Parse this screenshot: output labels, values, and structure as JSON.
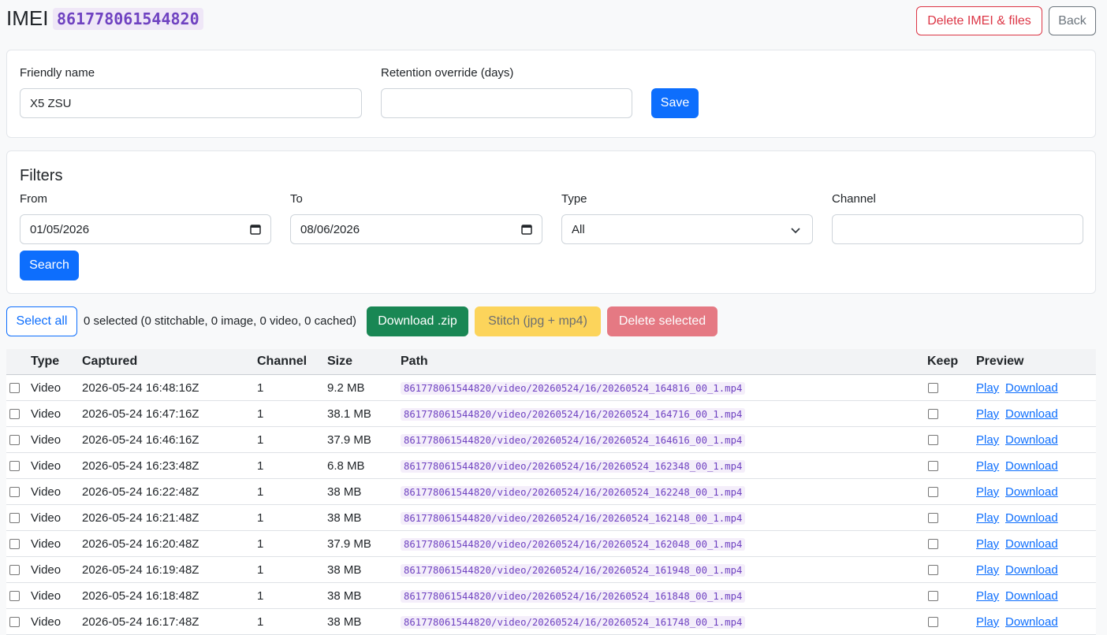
{
  "header": {
    "title": "IMEI",
    "imei": "861778061544820",
    "delete_button": "Delete IMEI & files",
    "back_button": "Back"
  },
  "settings": {
    "friendly_label": "Friendly name",
    "friendly_value": "X5 ZSU",
    "retention_label": "Retention override (days)",
    "retention_value": "",
    "save_button": "Save"
  },
  "filters": {
    "title": "Filters",
    "from_label": "From",
    "from_value": "01/05/2026",
    "to_label": "To",
    "to_value": "08/06/2026",
    "type_label": "Type",
    "type_value": "All",
    "channel_label": "Channel",
    "channel_value": "",
    "search_button": "Search"
  },
  "toolbar": {
    "select_all": "Select all",
    "selection_status": "0 selected (0 stitchable, 0 image, 0 video, 0 cached)",
    "download_zip": "Download .zip",
    "stitch": "Stitch (jpg + mp4)",
    "delete_selected": "Delete selected"
  },
  "table": {
    "headers": [
      "Type",
      "Captured",
      "Channel",
      "Size",
      "Path",
      "Keep",
      "Preview"
    ],
    "play_label": "Play",
    "download_label": "Download",
    "rows": [
      {
        "type": "Video",
        "captured": "2026-05-24 16:48:16Z",
        "channel": "1",
        "size": "9.2 MB",
        "path": "861778061544820/video/20260524/16/20260524_164816_00_1.mp4"
      },
      {
        "type": "Video",
        "captured": "2026-05-24 16:47:16Z",
        "channel": "1",
        "size": "38.1 MB",
        "path": "861778061544820/video/20260524/16/20260524_164716_00_1.mp4"
      },
      {
        "type": "Video",
        "captured": "2026-05-24 16:46:16Z",
        "channel": "1",
        "size": "37.9 MB",
        "path": "861778061544820/video/20260524/16/20260524_164616_00_1.mp4"
      },
      {
        "type": "Video",
        "captured": "2026-05-24 16:23:48Z",
        "channel": "1",
        "size": "6.8 MB",
        "path": "861778061544820/video/20260524/16/20260524_162348_00_1.mp4"
      },
      {
        "type": "Video",
        "captured": "2026-05-24 16:22:48Z",
        "channel": "1",
        "size": "38 MB",
        "path": "861778061544820/video/20260524/16/20260524_162248_00_1.mp4"
      },
      {
        "type": "Video",
        "captured": "2026-05-24 16:21:48Z",
        "channel": "1",
        "size": "38 MB",
        "path": "861778061544820/video/20260524/16/20260524_162148_00_1.mp4"
      },
      {
        "type": "Video",
        "captured": "2026-05-24 16:20:48Z",
        "channel": "1",
        "size": "37.9 MB",
        "path": "861778061544820/video/20260524/16/20260524_162048_00_1.mp4"
      },
      {
        "type": "Video",
        "captured": "2026-05-24 16:19:48Z",
        "channel": "1",
        "size": "38 MB",
        "path": "861778061544820/video/20260524/16/20260524_161948_00_1.mp4"
      },
      {
        "type": "Video",
        "captured": "2026-05-24 16:18:48Z",
        "channel": "1",
        "size": "38 MB",
        "path": "861778061544820/video/20260524/16/20260524_161848_00_1.mp4"
      },
      {
        "type": "Video",
        "captured": "2026-05-24 16:17:48Z",
        "channel": "1",
        "size": "38 MB",
        "path": "861778061544820/video/20260524/16/20260524_161748_00_1.mp4"
      }
    ]
  }
}
